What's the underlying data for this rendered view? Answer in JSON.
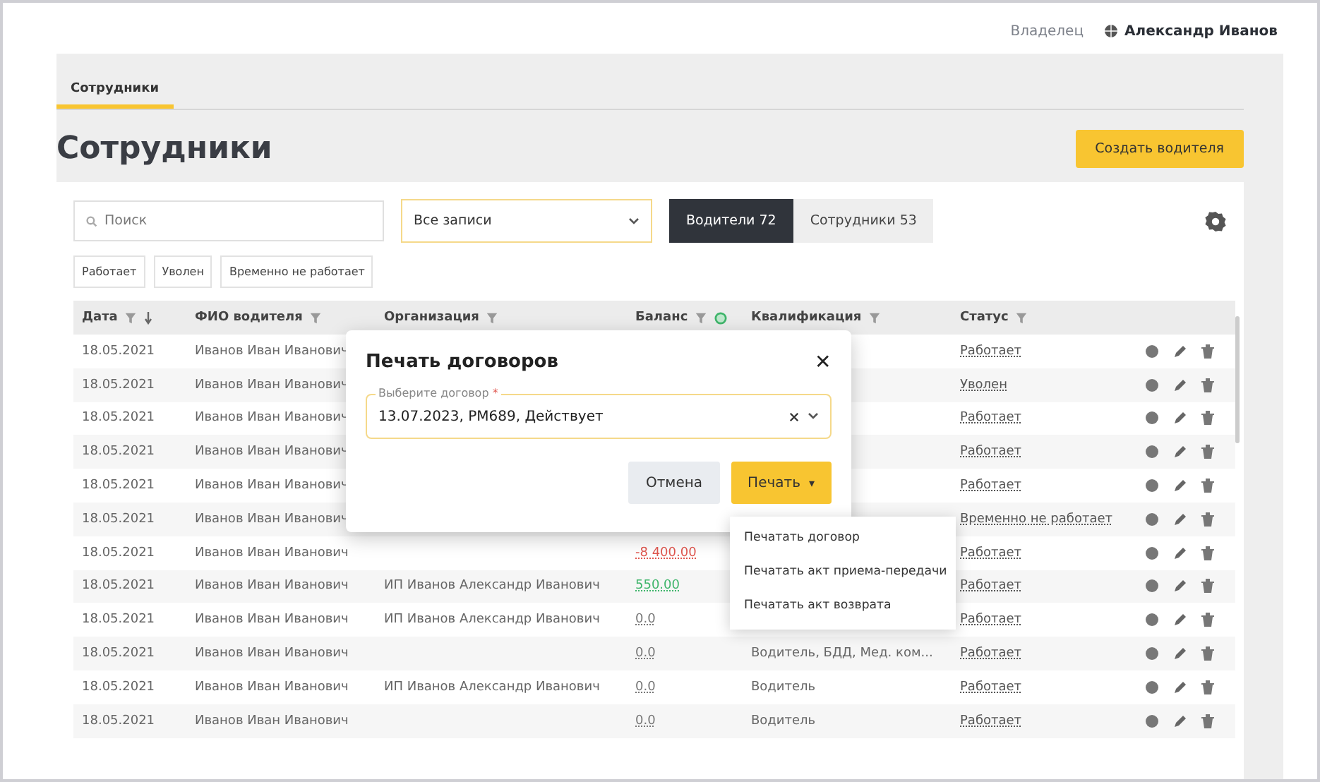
{
  "header": {
    "role": "Владелец",
    "user": "Александр Иванов"
  },
  "tabs": [
    {
      "label": "Сотрудники",
      "selected": true
    }
  ],
  "page_title": "Сотрудники",
  "create_button": "Создать водителя",
  "search": {
    "placeholder": "Поиск"
  },
  "records_select": {
    "value": "Все записи"
  },
  "segments": [
    {
      "label": "Водители 72",
      "selected": true
    },
    {
      "label": "Сотрудники 53",
      "selected": false
    }
  ],
  "status_chips": [
    "Работает",
    "Уволен",
    "Временно не работает"
  ],
  "table": {
    "columns": [
      "Дата",
      "ФИО водителя",
      "Организация",
      "Баланс",
      "Квалификация",
      "Статус"
    ],
    "rows": [
      {
        "date": "18.05.2021",
        "name": "Иванов Иван Иванович",
        "status": "Работает"
      },
      {
        "date": "18.05.2021",
        "name": "Иванов Иван Иванович",
        "status": "Уволен"
      },
      {
        "date": "18.05.2021",
        "name": "Иванов Иван Иванович",
        "status": "Работает"
      },
      {
        "date": "18.05.2021",
        "name": "Иванов Иван Иванович",
        "status": "Работает"
      },
      {
        "date": "18.05.2021",
        "name": "Иванов Иван Иванович",
        "status": "Работает"
      },
      {
        "date": "18.05.2021",
        "name": "Иванов Иван Иванович",
        "status": "Временно не работает"
      },
      {
        "date": "18.05.2021",
        "name": "Иванов Иван Иванович",
        "balance": "-8 400.00",
        "kind": "negative",
        "status": "Работает"
      },
      {
        "date": "18.05.2021",
        "name": "Иванов Иван Иванович",
        "org": "ИП Иванов Александр Иванович",
        "balance": "550.00",
        "kind": "positive",
        "status": "Работает"
      },
      {
        "date": "18.05.2021",
        "name": "Иванов Иван Иванович",
        "org": "ИП Иванов Александр Иванович",
        "balance": "0.0",
        "kind": "neutral",
        "status": "Работает"
      },
      {
        "date": "18.05.2021",
        "name": "Иванов Иван Иванович",
        "balance": "0.0",
        "kind": "neutral",
        "qualification": "Водитель, БДД, Мед. ком...",
        "status": "Работает"
      },
      {
        "date": "18.05.2021",
        "name": "Иванов Иван Иванович",
        "org": "ИП Иванов Александр Иванович",
        "balance": "0.0",
        "kind": "neutral",
        "qualification": "Водитель",
        "status": "Работает"
      },
      {
        "date": "18.05.2021",
        "name": "Иванов Иван Иванович",
        "balance": "0.0",
        "kind": "neutral",
        "qualification": "Водитель",
        "status": "Работает"
      }
    ]
  },
  "dialog": {
    "title": "Печать договоров",
    "close": "✕",
    "contract_field": {
      "label": "Выберите договор",
      "required": true,
      "required_mark": "*",
      "value": "13.07.2023, РМ689, Действует"
    },
    "buttons": [
      {
        "kind": "secondary",
        "label": "Отмена"
      },
      {
        "kind": "primary",
        "label": "Печать",
        "caret": "▾"
      }
    ]
  },
  "print_menu": [
    "Печатать договор",
    "Печатать акт приема-передачи",
    "Печатать акт возврата"
  ]
}
